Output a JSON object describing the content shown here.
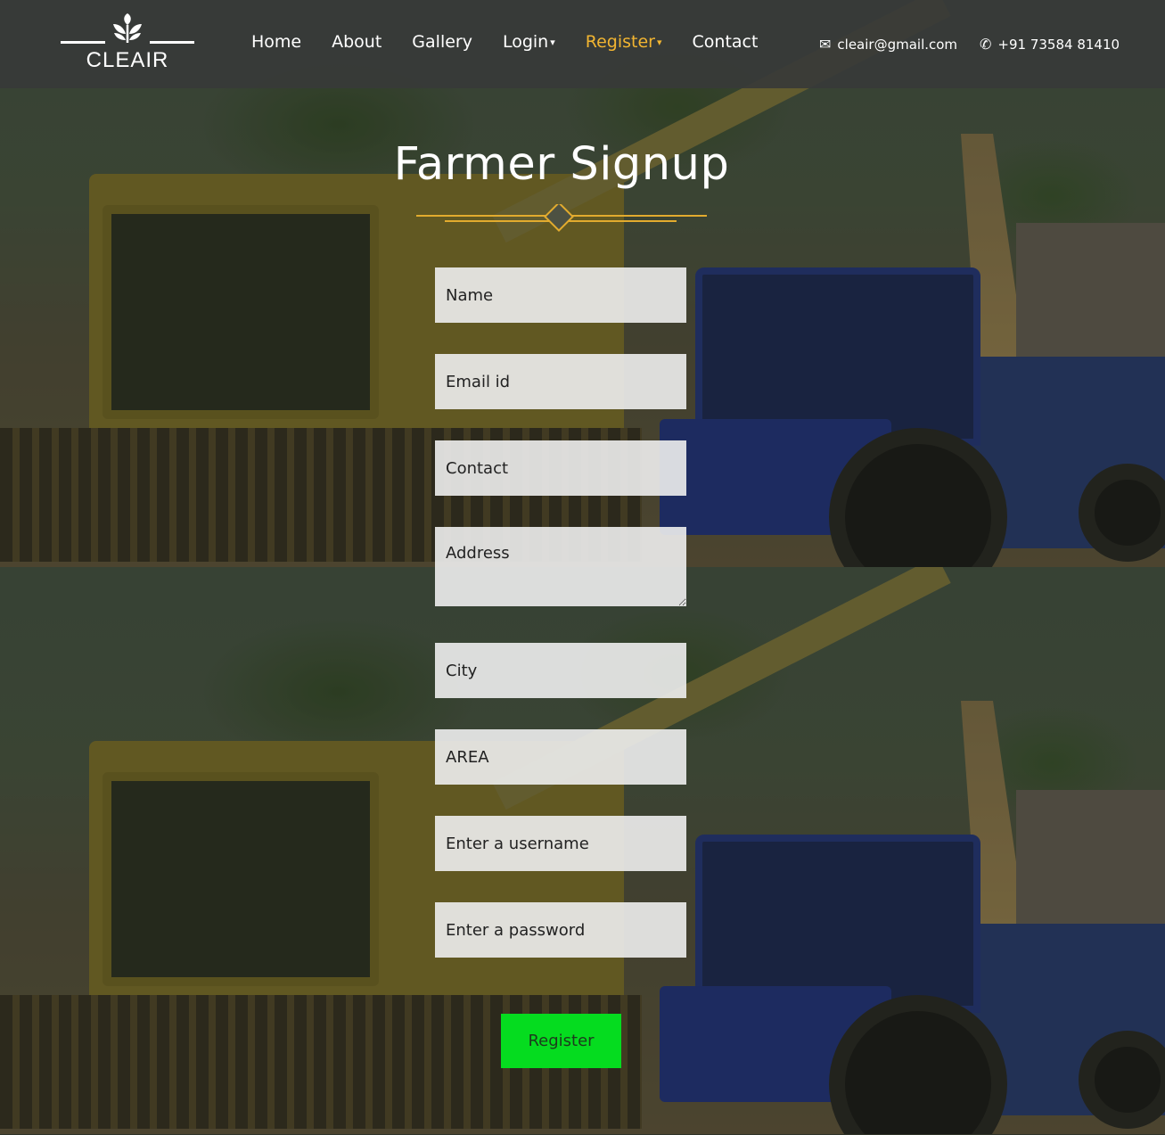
{
  "brand": {
    "name": "CLEAIR",
    "logo_icon": "sprout-icon"
  },
  "nav": {
    "items": [
      {
        "label": "Home",
        "dropdown": false,
        "active": false
      },
      {
        "label": "About",
        "dropdown": false,
        "active": false
      },
      {
        "label": "Gallery",
        "dropdown": false,
        "active": false
      },
      {
        "label": "Login",
        "dropdown": true,
        "active": false
      },
      {
        "label": "Register",
        "dropdown": true,
        "active": true
      },
      {
        "label": "Contact",
        "dropdown": false,
        "active": false
      }
    ],
    "caret": "▾",
    "accent_color": "#f2b531"
  },
  "contact": {
    "email": "cleair@gmail.com",
    "email_icon": "envelope-icon",
    "phone": "+91 73584 81410",
    "phone_icon": "phone-icon"
  },
  "page": {
    "title": "Farmer Signup"
  },
  "form": {
    "name_placeholder": "Name",
    "email_placeholder": "Email id",
    "contact_placeholder": "Contact",
    "address_placeholder": "Address",
    "city_placeholder": "City",
    "area_placeholder": "AREA",
    "username_placeholder": "Enter a username",
    "password_placeholder": "Enter a password",
    "submit_label": "Register",
    "submit_color": "#05dc1f"
  }
}
